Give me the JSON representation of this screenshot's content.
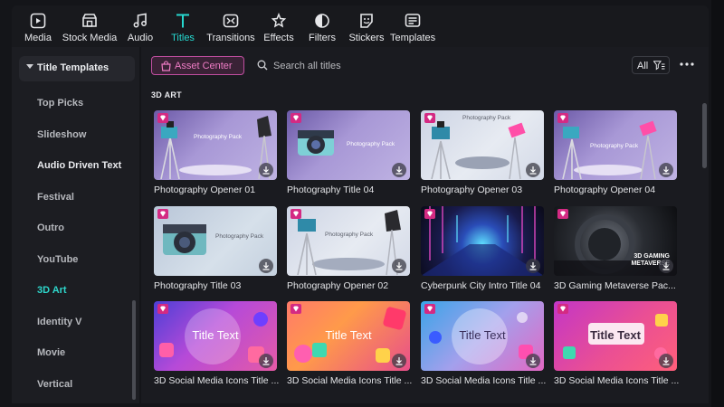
{
  "toolbar": {
    "items": [
      {
        "label": "Media",
        "icon": "media-icon"
      },
      {
        "label": "Stock Media",
        "icon": "stock-media-icon"
      },
      {
        "label": "Audio",
        "icon": "audio-icon"
      },
      {
        "label": "Titles",
        "icon": "titles-icon"
      },
      {
        "label": "Transitions",
        "icon": "transitions-icon"
      },
      {
        "label": "Effects",
        "icon": "effects-icon"
      },
      {
        "label": "Filters",
        "icon": "filters-icon"
      },
      {
        "label": "Stickers",
        "icon": "stickers-icon"
      },
      {
        "label": "Templates",
        "icon": "templates-icon"
      }
    ],
    "active": "Titles",
    "accent_color": "#26d8cf"
  },
  "sidebar": {
    "header": "Title Templates",
    "items": [
      {
        "label": "Top Picks"
      },
      {
        "label": "Slideshow"
      },
      {
        "label": "Audio Driven Text"
      },
      {
        "label": "Festival"
      },
      {
        "label": "Outro"
      },
      {
        "label": "YouTube"
      },
      {
        "label": "3D Art"
      },
      {
        "label": "Identity V"
      },
      {
        "label": "Movie"
      },
      {
        "label": "Vertical"
      }
    ],
    "active": "3D Art"
  },
  "topbar": {
    "asset_center_label": "Asset Center",
    "search_placeholder": "Search all titles",
    "filter_label": "All",
    "asset_color": "#ef7cc5"
  },
  "section_title": "3D ART",
  "cards": [
    {
      "title": "Photography Opener 01",
      "thumb_text": "Photography Pack",
      "style": "purple"
    },
    {
      "title": "Photography Title 04",
      "thumb_text": "Photography Pack",
      "style": "purple"
    },
    {
      "title": "Photography Opener 03",
      "thumb_text": "Photography Pack",
      "style": "silver"
    },
    {
      "title": "Photography Opener 04",
      "thumb_text": "Photography Pack",
      "style": "purple"
    },
    {
      "title": "Photography Title 03",
      "thumb_text": "Photography Pack",
      "style": "mint"
    },
    {
      "title": "Photography Opener 02",
      "thumb_text": "Photography Pack",
      "style": "silver"
    },
    {
      "title": "Cyberpunk City Intro Title 04",
      "thumb_text": "",
      "style": "cyber"
    },
    {
      "title": "3D Gaming Metaverse Pac...",
      "thumb_text": "3D GAMING\nMETAVERSE",
      "style": "dark"
    },
    {
      "title": "3D Social Media Icons Title ...",
      "thumb_text": "Title Text",
      "style": "pinkblue"
    },
    {
      "title": "3D Social Media Icons Title ...",
      "thumb_text": "Title Text",
      "style": "coral"
    },
    {
      "title": "3D Social Media Icons Title ...",
      "thumb_text": "Title Text",
      "style": "sky"
    },
    {
      "title": "3D Social Media Icons Title ...",
      "thumb_text": "Title Text",
      "style": "magenta"
    }
  ]
}
